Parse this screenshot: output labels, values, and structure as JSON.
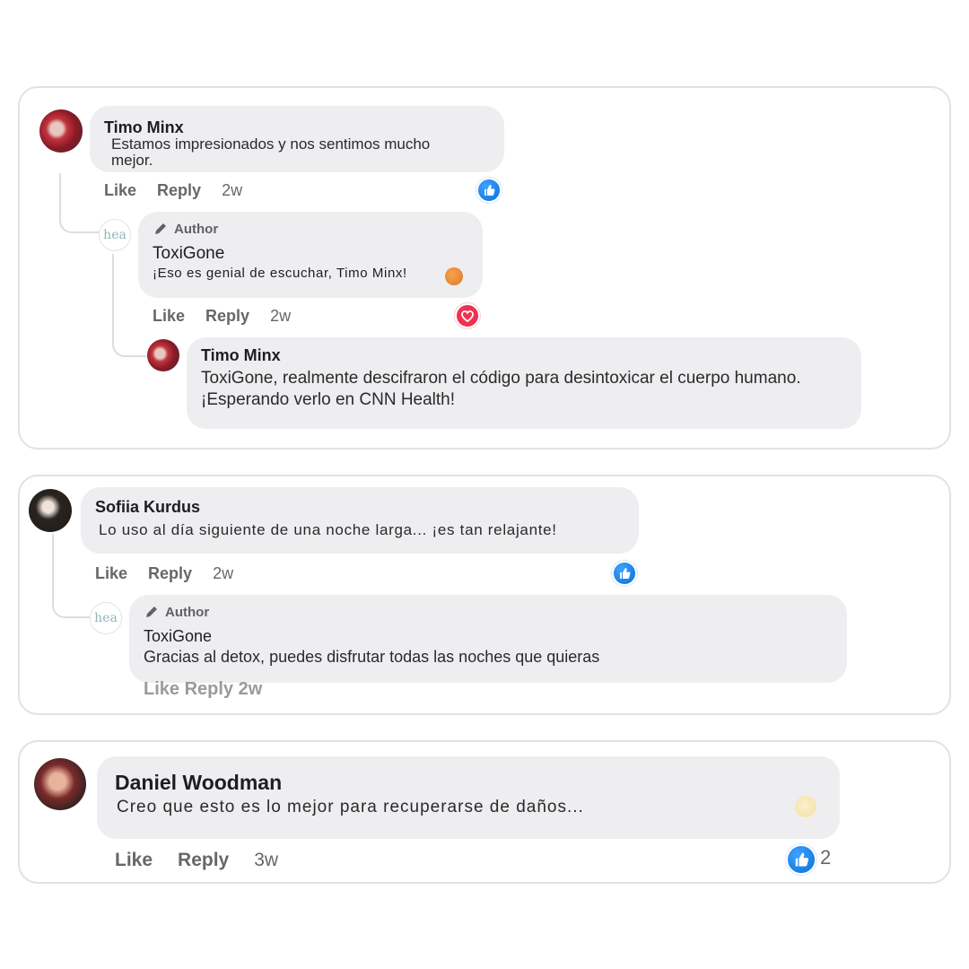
{
  "threads": [
    {
      "comment": {
        "name": "Timo Minx",
        "text": "Estamos impresionados y nos sentimos mucho mejor.",
        "actions": {
          "like": "Like",
          "reply": "Reply",
          "time": "2w"
        }
      },
      "reply": {
        "tag": "Author",
        "name": "ToxiGone",
        "text": "¡Eso es genial de escuchar, Timo Minx!",
        "logo_text": "hea",
        "actions": {
          "like": "Like",
          "reply": "Reply",
          "time": "2w"
        }
      },
      "sub_reply": {
        "name": "Timo Minx",
        "text": "ToxiGone, realmente descifraron el código para desintoxicar el cuerpo humano. ¡Esperando verlo en CNN Health!"
      }
    },
    {
      "comment": {
        "name": "Sofiia Kurdus",
        "text": "Lo uso al día siguiente de una noche larga... ¡es tan relajante!",
        "actions": {
          "like": "Like",
          "reply": "Reply",
          "time": "2w"
        }
      },
      "reply": {
        "tag": "Author",
        "name": "ToxiGone",
        "text": "Gracias al detox, puedes disfrutar todas las noches que quieras",
        "logo_text": "hea",
        "actions_text": "Like Reply 2w"
      }
    },
    {
      "comment": {
        "name": "Daniel Woodman",
        "text": "Creo que esto es lo mejor para recuperarse de daños...",
        "actions": {
          "like": "Like",
          "reply": "Reply",
          "time": "3w"
        },
        "like_count": "2"
      }
    }
  ],
  "colors": {
    "like_blue": "#0a6fd8",
    "heart_red": "#f0314f",
    "bubble": "#eeeef1",
    "muted_text": "#65676b"
  },
  "icons": [
    "like-reaction-icon",
    "love-reaction-icon",
    "pencil-icon",
    "peach-emoji-icon",
    "hands-emoji-icon"
  ]
}
